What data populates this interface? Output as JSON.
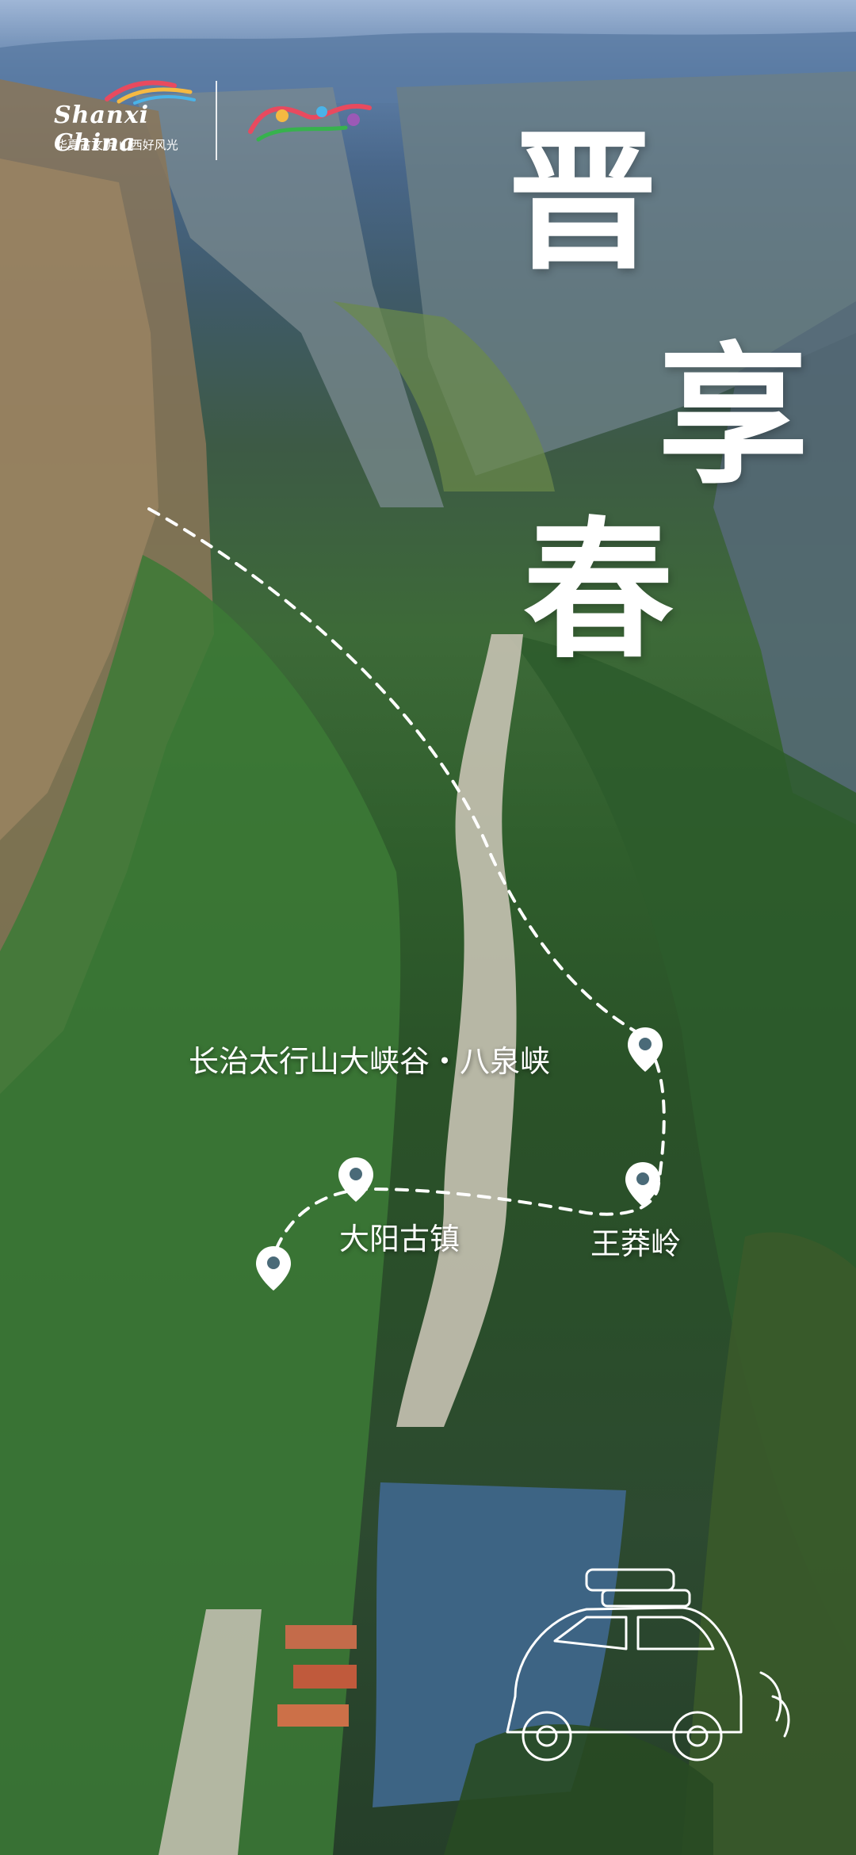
{
  "title": {
    "char1": "晋",
    "char2": "享",
    "char3": "春"
  },
  "logos": {
    "brand_text": "Shanxi China",
    "brand_tagline": "华夏古文明 山西好风光"
  },
  "route": {
    "stops": [
      {
        "label": "长治太行山大峡谷・八泉峡"
      },
      {
        "label": "王莽岭"
      },
      {
        "label": "大阳古镇"
      }
    ]
  },
  "icons": [
    "map-pin-icon",
    "car-illustration-icon"
  ],
  "colors": {
    "sky": "#9fb6d6",
    "mountain": "#3d5a45",
    "water": "#4a6f8e",
    "route_line": "#ffffff"
  }
}
